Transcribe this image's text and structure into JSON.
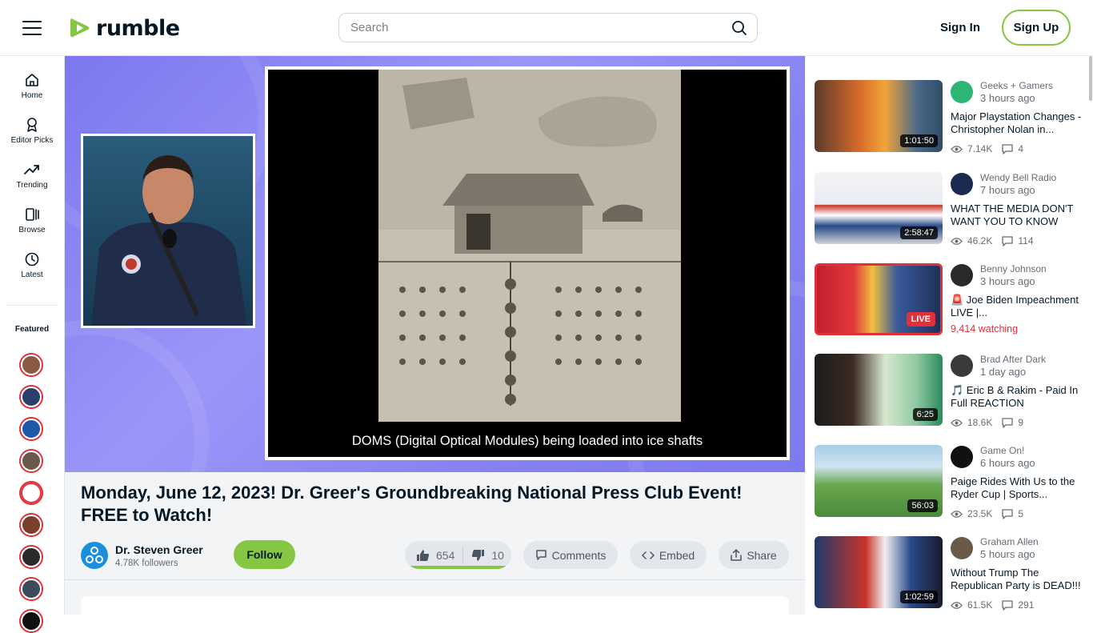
{
  "header": {
    "logo_text": "rumble",
    "search_placeholder": "Search",
    "sign_in": "Sign In",
    "sign_up": "Sign Up"
  },
  "nav": {
    "items": [
      {
        "label": "Home",
        "icon": "home-icon"
      },
      {
        "label": "Editor Picks",
        "icon": "award-icon"
      },
      {
        "label": "Trending",
        "icon": "trending-icon"
      },
      {
        "label": "Browse",
        "icon": "browse-icon"
      },
      {
        "label": "Latest",
        "icon": "clock-icon"
      }
    ],
    "featured_label": "Featured"
  },
  "video": {
    "slide_caption": "DOMS (Digital Optical Modules) being loaded into ice shafts",
    "title": "Monday, June 12, 2023! Dr. Greer's Groundbreaking National Press Club Event! FREE to Watch!",
    "channel": "Dr. Steven Greer",
    "followers": "4.78K followers",
    "follow_label": "Follow",
    "likes": "654",
    "dislikes": "10",
    "comments_label": "Comments",
    "embed_label": "Embed",
    "share_label": "Share"
  },
  "recommendations": [
    {
      "channel": "Geeks + Gamers",
      "time": "3 hours ago",
      "title": "Major Playstation Changes - Christopher Nolan in...",
      "duration": "1:01:50",
      "views": "7.14K",
      "comments": "4"
    },
    {
      "channel": "Wendy Bell Radio",
      "time": "7 hours ago",
      "title": "WHAT THE MEDIA DON'T WANT YOU TO KNOW",
      "duration": "2:58:47",
      "views": "46.2K",
      "comments": "114"
    },
    {
      "channel": "Benny Johnson",
      "time": "3 hours ago",
      "title": "🚨 Joe Biden Impeachment LIVE |...",
      "live_label": "LIVE",
      "watching": "9,414 watching"
    },
    {
      "channel": "Brad After Dark",
      "time": "1 day ago",
      "title": "🎵 Eric B & Rakim - Paid In Full REACTION",
      "duration": "6:25",
      "views": "18.6K",
      "comments": "9"
    },
    {
      "channel": "Game On!",
      "time": "6 hours ago",
      "title": "Paige Rides With Us to the Ryder Cup | Sports...",
      "duration": "56:03",
      "views": "23.5K",
      "comments": "5"
    },
    {
      "channel": "Graham Allen",
      "time": "5 hours ago",
      "title": "Without Trump The Republican Party is DEAD!!!",
      "duration": "1:02:59",
      "views": "61.5K",
      "comments": "291"
    }
  ],
  "colors": {
    "brand_green": "#85c742",
    "text_dark": "#061826",
    "live_red": "#e0313a",
    "muted": "#646d76"
  }
}
